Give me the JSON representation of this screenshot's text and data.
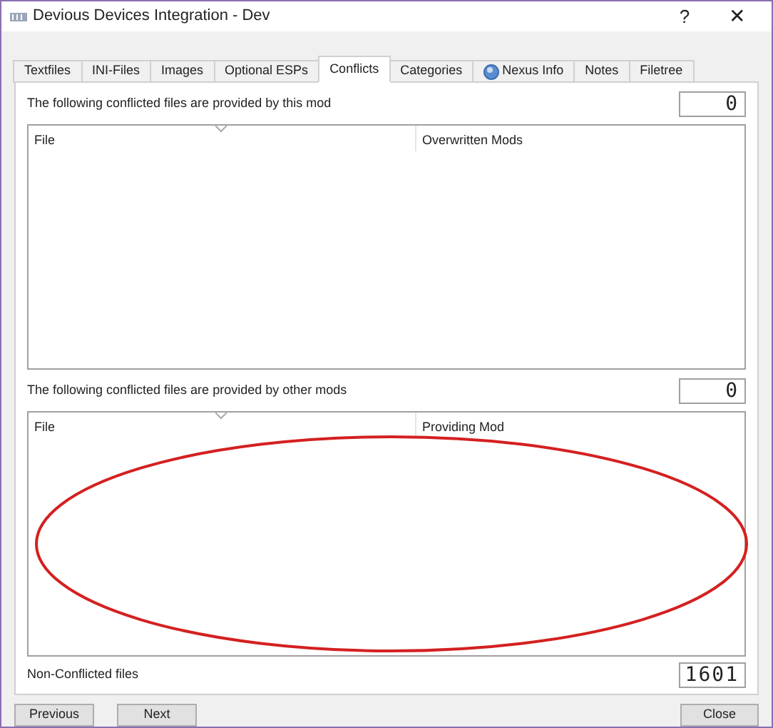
{
  "window": {
    "title": "Devious Devices Integration - Dev",
    "help": "?",
    "close": "✕"
  },
  "tabs": [
    {
      "label": "Textfiles",
      "selected": false
    },
    {
      "label": "INI-Files",
      "selected": false
    },
    {
      "label": "Images",
      "selected": false
    },
    {
      "label": "Optional ESPs",
      "selected": false
    },
    {
      "label": "Conflicts",
      "selected": true
    },
    {
      "label": "Categories",
      "selected": false
    },
    {
      "label": "Nexus Info",
      "selected": false,
      "kind": "globe"
    },
    {
      "label": "Notes",
      "selected": false
    },
    {
      "label": "Filetree",
      "selected": false
    }
  ],
  "sections": [
    {
      "label": "The following conflicted files are provided by this mod",
      "count": "0",
      "columns": [
        "File",
        "Overwritten Mods"
      ],
      "annotated": false
    },
    {
      "label": "The following conflicted files are provided by other mods",
      "count": "0",
      "columns": [
        "File",
        "Providing Mod"
      ],
      "annotated": true
    }
  ],
  "non_conflicted": {
    "label": "Non-Conflicted files",
    "count": "1601"
  },
  "buttons": {
    "left": [
      "Previous",
      "Next"
    ],
    "right": [
      "Close"
    ]
  }
}
